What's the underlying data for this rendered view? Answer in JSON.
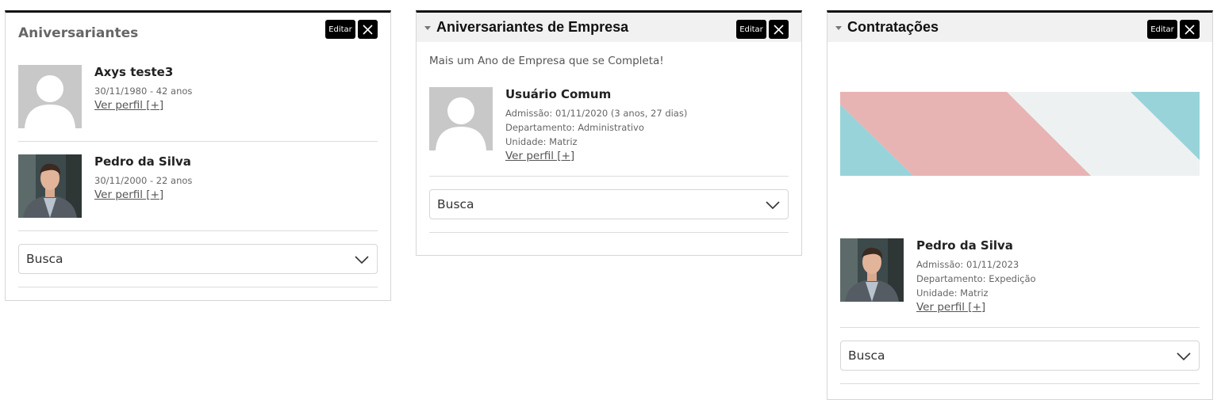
{
  "common": {
    "edit_label": "Editar",
    "view_profile_label": "Ver perfil [+]",
    "search_label": "Busca"
  },
  "birthdays": {
    "title": "Aniversariantes",
    "people": [
      {
        "name": "Axys teste3",
        "detail": "30/11/1980 - 42 anos",
        "avatar": "placeholder-avatar"
      },
      {
        "name": "Pedro da Silva",
        "detail": "30/11/2000 - 22 anos",
        "avatar": "photo-avatar"
      }
    ]
  },
  "company_anniversaries": {
    "title": "Aniversariantes de Empresa",
    "intro": "Mais um Ano de Empresa que se Completa!",
    "people": [
      {
        "name": "Usuário Comum",
        "admission": "Admissão: 01/11/2020 (3 anos, 27 dias)",
        "department": "Departamento: Administrativo",
        "unit": "Unidade: Matriz",
        "avatar": "placeholder-avatar"
      }
    ]
  },
  "hires": {
    "title": "Contratações",
    "banner_colors": [
      "#98d3da",
      "#e8b4b3",
      "#eef1f1"
    ],
    "people": [
      {
        "name": "Pedro da Silva",
        "admission": "Admissão: 01/11/2023",
        "department": "Departamento: Expedição",
        "unit": "Unidade: Matriz",
        "avatar": "photo-avatar"
      }
    ]
  }
}
